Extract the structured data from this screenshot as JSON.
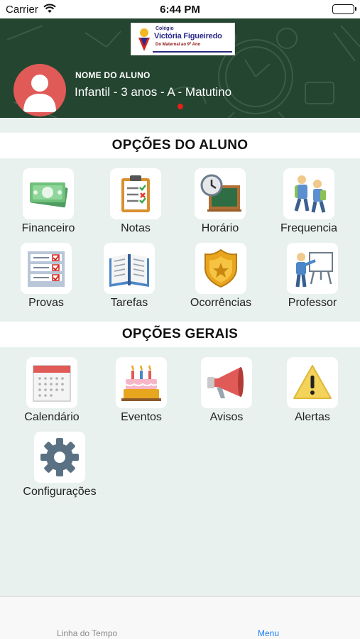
{
  "status_bar": {
    "carrier": "Carrier",
    "time": "6:44 PM"
  },
  "header": {
    "logo": {
      "line1": "Colégio",
      "line2": "Victória Figueiredo",
      "line3": "Do Maternal ao 9º Ano"
    },
    "student_name": "NOME DO ALUNO",
    "student_class": "Infantil - 3 anos - A - Matutino",
    "indicator_color": "#e2231a"
  },
  "student_section": {
    "title": "OPÇÕES DO ALUNO",
    "items": [
      {
        "label": "Financeiro",
        "icon": "money-icon"
      },
      {
        "label": "Notas",
        "icon": "clipboard-icon"
      },
      {
        "label": "Horário",
        "icon": "clock-board-icon"
      },
      {
        "label": "Frequencia",
        "icon": "students-icon"
      },
      {
        "label": "Provas",
        "icon": "checklist-icon"
      },
      {
        "label": "Tarefas",
        "icon": "book-icon"
      },
      {
        "label": "Ocorrências",
        "icon": "badge-icon"
      },
      {
        "label": "Professor",
        "icon": "teacher-icon"
      }
    ]
  },
  "general_section": {
    "title": "OPÇÕES GERAIS",
    "items": [
      {
        "label": "Calendário",
        "icon": "calendar-icon"
      },
      {
        "label": "Eventos",
        "icon": "cake-icon"
      },
      {
        "label": "Avisos",
        "icon": "megaphone-icon"
      },
      {
        "label": "Alertas",
        "icon": "warning-icon"
      },
      {
        "label": "Configurações",
        "icon": "gear-icon"
      }
    ]
  },
  "tab_bar": {
    "tabs": [
      {
        "label": "Linha do Tempo",
        "active": false
      },
      {
        "label": "Menu",
        "active": true
      }
    ],
    "active_color": "#1a7ef5"
  }
}
